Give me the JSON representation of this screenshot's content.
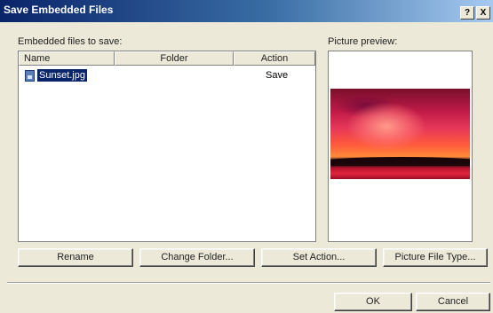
{
  "window": {
    "title": "Save Embedded Files",
    "help_label": "?",
    "close_label": "X"
  },
  "embedded": {
    "label": "Embedded files to save:",
    "columns": [
      "Name",
      "Folder",
      "Action"
    ],
    "rows": [
      {
        "name": "Sunset.jpg",
        "folder": "",
        "action": "Save",
        "selected": true
      }
    ]
  },
  "preview": {
    "label": "Picture preview:",
    "image_description": "sunset-photo"
  },
  "buttons": {
    "rename": "Rename",
    "change_folder": "Change Folder...",
    "set_action": "Set Action...",
    "picture_file_type": "Picture File Type...",
    "ok": "OK",
    "cancel": "Cancel"
  },
  "colors": {
    "titlebar_start": "#0a246a",
    "titlebar_end": "#a6caf0",
    "selection": "#0a246a",
    "dialog_bg": "#ece9d8"
  }
}
